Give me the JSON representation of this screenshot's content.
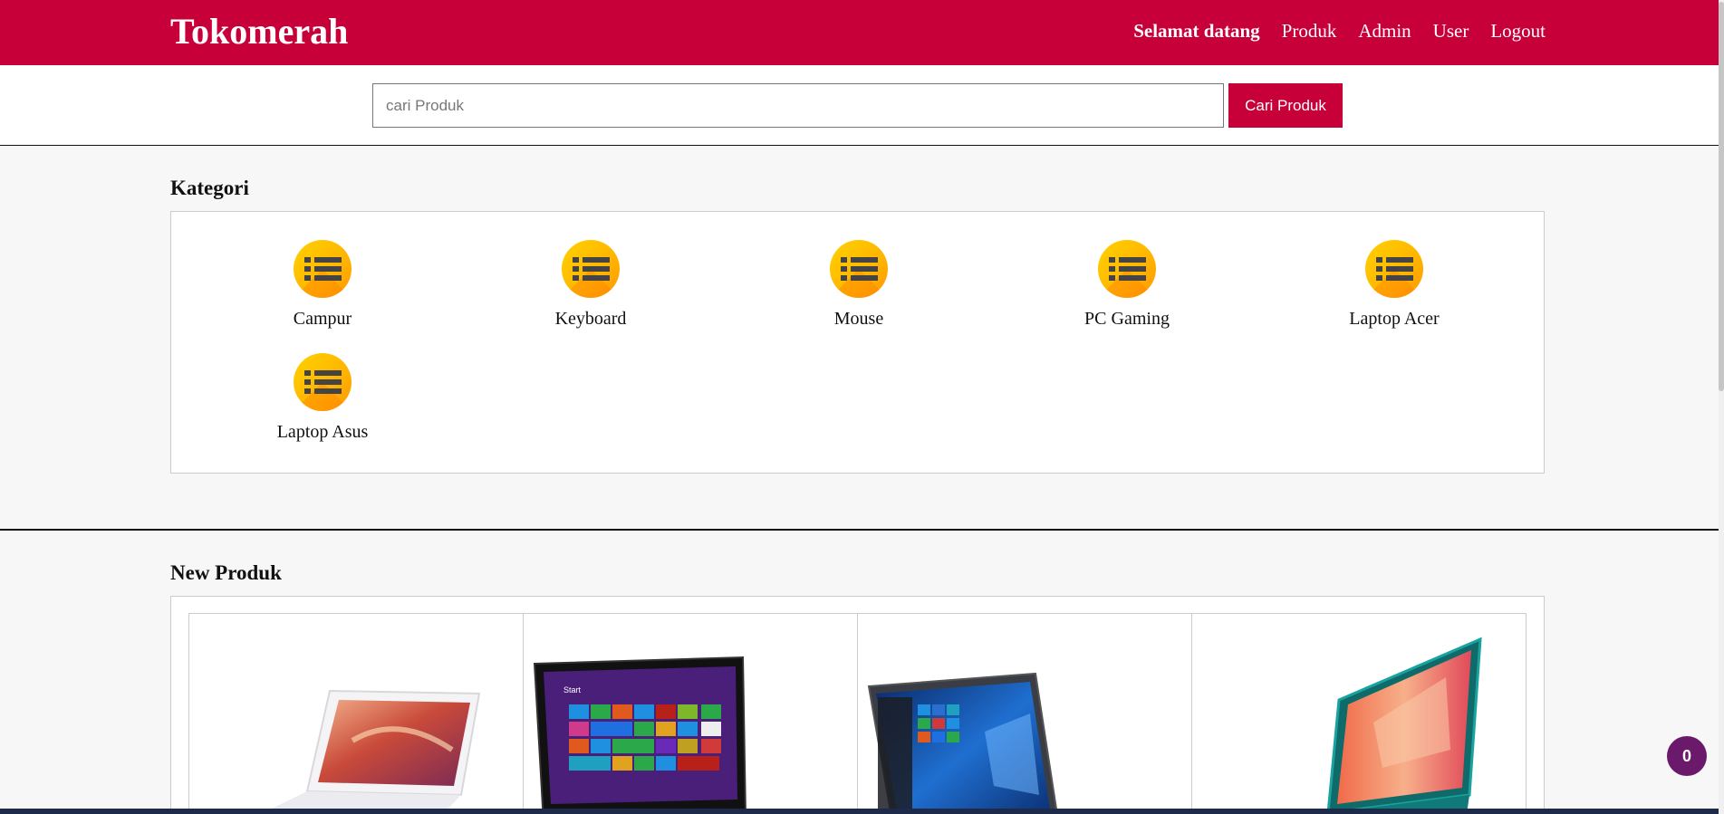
{
  "header": {
    "brand": "Tokomerah",
    "nav": {
      "welcome": "Selamat datang",
      "produk": "Produk",
      "admin": "Admin",
      "user": "User",
      "logout": "Logout"
    }
  },
  "search": {
    "placeholder": "cari Produk",
    "button_label": "Cari Produk"
  },
  "kategori": {
    "title": "Kategori",
    "items": [
      {
        "label": "Campur",
        "icon": "list-icon"
      },
      {
        "label": "Keyboard",
        "icon": "list-icon"
      },
      {
        "label": "Mouse",
        "icon": "list-icon"
      },
      {
        "label": "PC Gaming",
        "icon": "list-icon"
      },
      {
        "label": "Laptop Acer",
        "icon": "list-icon"
      },
      {
        "label": "Laptop Asus",
        "icon": "list-icon"
      }
    ]
  },
  "produk": {
    "title": "New Produk",
    "cards": [
      {
        "image": "laptop-asus-white-image"
      },
      {
        "image": "laptop-asus-win8-image"
      },
      {
        "image": "laptop-grey-win10-image"
      },
      {
        "image": "laptop-asus-vivobook-teal-image"
      }
    ]
  },
  "cart": {
    "count": "0"
  },
  "colors": {
    "brand": "#c8003a",
    "cart_badge": "#6b1a6b",
    "category_icon": "#ffc400"
  }
}
